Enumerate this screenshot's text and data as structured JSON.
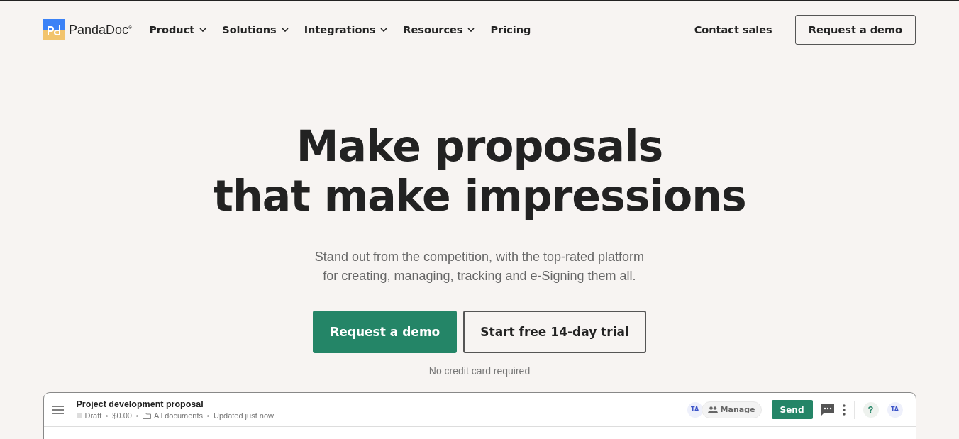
{
  "logo": {
    "text": "PandaDoc",
    "mark": "®"
  },
  "nav": [
    {
      "label": "Product",
      "dropdown": true
    },
    {
      "label": "Solutions",
      "dropdown": true
    },
    {
      "label": "Integrations",
      "dropdown": true
    },
    {
      "label": "Resources",
      "dropdown": true
    },
    {
      "label": "Pricing",
      "dropdown": false
    }
  ],
  "contact": "Contact sales",
  "header_button": "Request a demo",
  "hero": {
    "title_lines": [
      "Make proposals",
      "that make impressions"
    ],
    "subtitle_lines": [
      "Stand out from the competition, with the top-rated platform",
      "for creating, managing, tracking and e-Signing them all."
    ],
    "primary": "Request a demo",
    "secondary": "Start free 14-day trial",
    "note": "No credit card required"
  },
  "app": {
    "doc_title": "Project development proposal",
    "status": "Draft",
    "amount": "$0.00",
    "folder": "All documents",
    "updated": "Updated just now",
    "avatar": "TA",
    "manage": "Manage",
    "send": "Send",
    "help": "?",
    "user": "TA"
  }
}
